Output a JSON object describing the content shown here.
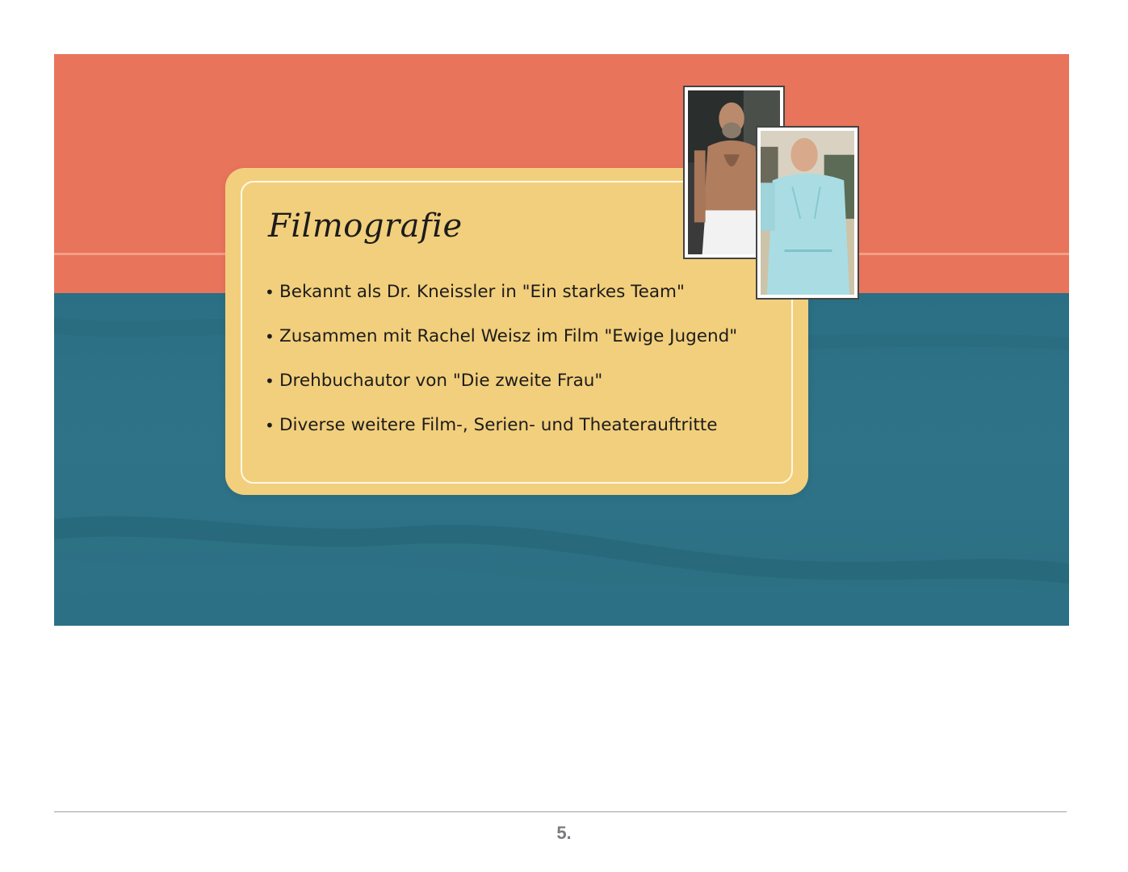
{
  "slide": {
    "title": "Filmografie",
    "bullets": [
      "Bekannt als Dr. Kneissler in \"Ein starkes Team\"",
      "Zusammen mit Rachel Weisz im Film \"Ewige Jugend\"",
      "Drehbuchautor von \"Die zweite Frau\"",
      "Diverse weitere Film-, Serien- und Theaterauftritte"
    ],
    "bullet_symbol": "•",
    "colors": {
      "top_band": "#e8745c",
      "bottom_band": "#2b6f84",
      "card": "#f2cf7c",
      "card_border": "#fff8e6"
    },
    "photos": [
      {
        "icon": "portrait-photo-man-towel"
      },
      {
        "icon": "portrait-photo-man-hospital-gown"
      }
    ]
  },
  "footer": {
    "page_number": "5."
  }
}
